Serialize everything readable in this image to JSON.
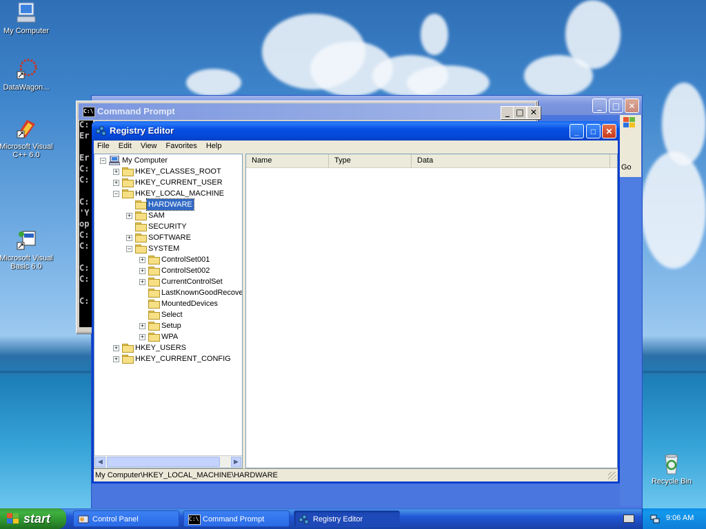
{
  "desktop": {
    "icons": [
      {
        "label": "My Computer"
      },
      {
        "label": "DataWagon..."
      },
      {
        "label": "Microsoft Visual C++ 6.0"
      },
      {
        "label": "Microsoft Visual Basic 6.0"
      },
      {
        "label": "Recycle Bin"
      }
    ]
  },
  "cmd_window": {
    "title": "Command Prompt",
    "console_lines": [
      "C:",
      "Er",
      "",
      "Er",
      "C:",
      "C:",
      "",
      "C:",
      "'Y",
      "op",
      "C:",
      "C:",
      "",
      "C:",
      "C:",
      "",
      "C:"
    ]
  },
  "control_panel": {
    "go_label": "Go"
  },
  "regedit": {
    "title": "Registry Editor",
    "menu": [
      "File",
      "Edit",
      "View",
      "Favorites",
      "Help"
    ],
    "tree": [
      {
        "label": "My Computer"
      },
      {
        "label": "HKEY_CLASSES_ROOT"
      },
      {
        "label": "HKEY_CURRENT_USER"
      },
      {
        "label": "HKEY_LOCAL_MACHINE"
      },
      {
        "label": "HARDWARE"
      },
      {
        "label": "SAM"
      },
      {
        "label": "SECURITY"
      },
      {
        "label": "SOFTWARE"
      },
      {
        "label": "SYSTEM"
      },
      {
        "label": "ControlSet001"
      },
      {
        "label": "ControlSet002"
      },
      {
        "label": "CurrentControlSet"
      },
      {
        "label": "LastKnownGoodRecove"
      },
      {
        "label": "MountedDevices"
      },
      {
        "label": "Select"
      },
      {
        "label": "Setup"
      },
      {
        "label": "WPA"
      },
      {
        "label": "HKEY_USERS"
      },
      {
        "label": "HKEY_CURRENT_CONFIG"
      }
    ],
    "columns": [
      "Name",
      "Type",
      "Data"
    ],
    "status": "My Computer\\HKEY_LOCAL_MACHINE\\HARDWARE"
  },
  "taskbar": {
    "start_label": "start",
    "tasks": [
      {
        "label": "Control Panel"
      },
      {
        "label": "Command Prompt"
      },
      {
        "label": "Registry Editor"
      }
    ],
    "clock": "9:06 AM"
  }
}
